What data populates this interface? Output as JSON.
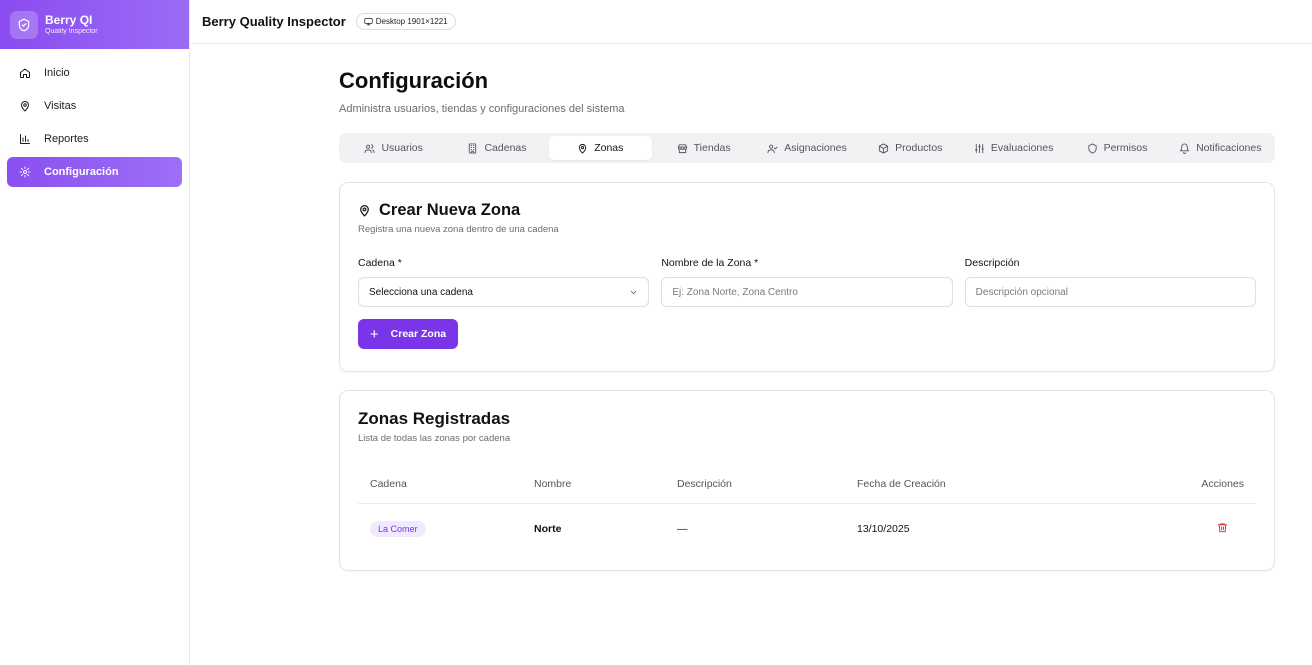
{
  "app": {
    "name": "Berry QI",
    "subtitle": "Quality Inspector"
  },
  "sidebar": {
    "items": [
      {
        "label": "Inicio",
        "icon": "home-icon"
      },
      {
        "label": "Visitas",
        "icon": "map-pin-icon"
      },
      {
        "label": "Reportes",
        "icon": "bar-chart-icon"
      },
      {
        "label": "Configuración",
        "icon": "gear-icon",
        "active": true
      }
    ]
  },
  "topbar": {
    "title": "Berry Quality Inspector",
    "viewport": "Desktop 1901×1221"
  },
  "page": {
    "title": "Configuración",
    "subtitle": "Administra usuarios, tiendas y configuraciones del sistema"
  },
  "tabs": [
    {
      "label": "Usuarios",
      "icon": "users-icon"
    },
    {
      "label": "Cadenas",
      "icon": "building-icon"
    },
    {
      "label": "Zonas",
      "icon": "map-pin-icon",
      "active": true
    },
    {
      "label": "Tiendas",
      "icon": "store-icon"
    },
    {
      "label": "Asignaciones",
      "icon": "user-check-icon"
    },
    {
      "label": "Productos",
      "icon": "package-icon"
    },
    {
      "label": "Evaluaciones",
      "icon": "sliders-icon"
    },
    {
      "label": "Permisos",
      "icon": "shield-icon"
    },
    {
      "label": "Notificaciones",
      "icon": "bell-icon"
    }
  ],
  "create_card": {
    "title": "Crear Nueva Zona",
    "subtitle": "Registra una nueva zona dentro de una cadena",
    "cadena_label": "Cadena *",
    "cadena_value": "Selecciona una cadena",
    "nombre_label": "Nombre de la Zona *",
    "nombre_placeholder": "Ej: Zona Norte, Zona Centro",
    "descripcion_label": "Descripción",
    "descripcion_placeholder": "Descripción opcional",
    "button_label": "Crear Zona"
  },
  "list_card": {
    "title": "Zonas Registradas",
    "subtitle": "Lista de todas las zonas por cadena",
    "columns": [
      "Cadena",
      "Nombre",
      "Descripción",
      "Fecha de Creación",
      "Acciones"
    ],
    "rows": [
      {
        "cadena": "La Comer",
        "nombre": "Norte",
        "descripcion": "—",
        "fecha": "13/10/2025"
      }
    ]
  },
  "colors": {
    "accent": "#7b35e8",
    "danger": "#e53935"
  }
}
